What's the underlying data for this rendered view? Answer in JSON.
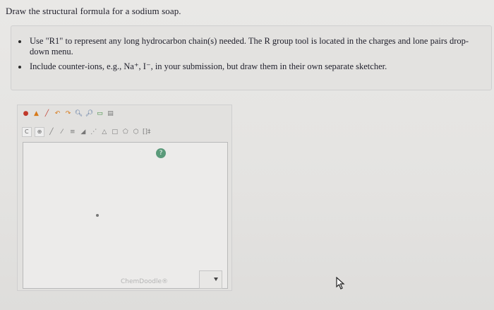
{
  "question": "Draw the structural formula for a sodium soap.",
  "instructions": [
    "Use \"R1\" to represent any long hydrocarbon chain(s) needed. The R group tool is located in the charges and lone pairs drop-down menu.",
    "Include counter-ions, e.g., Na⁺, I⁻, in your submission, but draw them in their own separate sketcher."
  ],
  "sketcher": {
    "toolbar1": [
      "eraser-icon",
      "lasso-icon",
      "pencil-icon",
      "undo-icon",
      "redo-icon",
      "zoom-in-icon",
      "zoom-out-icon",
      "clear-icon",
      "paste-icon"
    ],
    "element_select": "C",
    "charge_select": "⊕",
    "toolbar2_extra": "[]‡",
    "help_label": "?",
    "watermark": "ChemDoodle®"
  },
  "answer_dropdown": {
    "value": ""
  }
}
